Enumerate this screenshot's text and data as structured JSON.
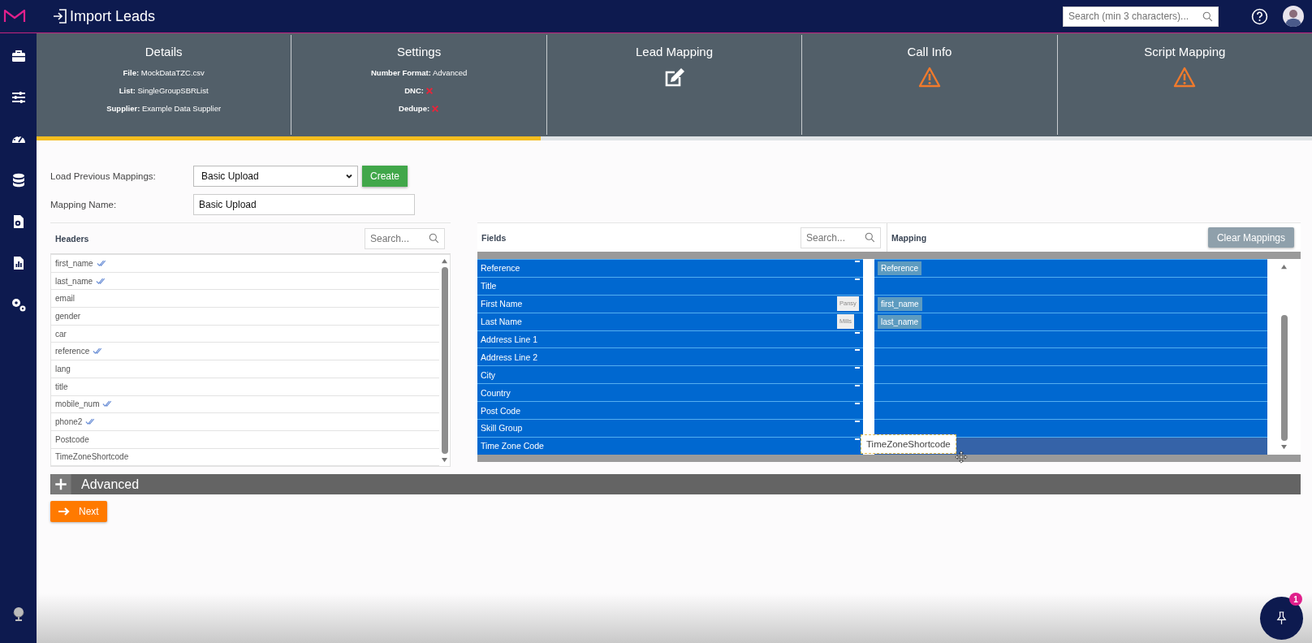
{
  "header": {
    "title": "Import Leads",
    "search": {
      "placeholder": "Search (min 3 characters)..."
    }
  },
  "steps": [
    {
      "title": "Details",
      "kind": "summary",
      "lines": [
        {
          "label": "File:",
          "value": "MockDataTZC.csv"
        },
        {
          "label": "List:",
          "value": "SingleGroupSBRList"
        },
        {
          "label": "Supplier:",
          "value": "Example Data Supplier"
        }
      ]
    },
    {
      "title": "Settings",
      "kind": "summary",
      "lines": [
        {
          "label": "Number Format:",
          "value": "Advanced"
        },
        {
          "label": "DNC:",
          "on": false
        },
        {
          "label": "Dedupe:",
          "on": false
        }
      ]
    },
    {
      "title": "Lead Mapping",
      "kind": "edit"
    },
    {
      "title": "Call Info",
      "kind": "warning"
    },
    {
      "title": "Script Mapping",
      "kind": "warning"
    }
  ],
  "progress": {
    "level": 0.395
  },
  "form": {
    "load_previous": {
      "label": "Load Previous Mappings:",
      "value": "Basic Upload"
    },
    "create_button": "Create",
    "mapping_name": {
      "label": "Mapping Name:",
      "value": "Basic Upload"
    }
  },
  "headers_panel": {
    "title": "Headers",
    "search": {
      "placeholder": "Search..."
    },
    "items": [
      {
        "label": "first_name",
        "mapped": true
      },
      {
        "label": "last_name",
        "mapped": true
      },
      {
        "label": "email",
        "mapped": false
      },
      {
        "label": "gender",
        "mapped": false
      },
      {
        "label": "car",
        "mapped": false
      },
      {
        "label": "reference",
        "mapped": true
      },
      {
        "label": "lang",
        "mapped": false
      },
      {
        "label": "title",
        "mapped": false
      },
      {
        "label": "mobile_num",
        "mapped": true
      },
      {
        "label": "phone2",
        "mapped": true
      },
      {
        "label": "Postcode",
        "mapped": false
      },
      {
        "label": "TimeZoneShortcode",
        "mapped": false
      }
    ]
  },
  "fields_panel": {
    "title": "Fields",
    "search": {
      "placeholder": "Search..."
    },
    "mapping_title": "Mapping",
    "clear_button": "Clear Mappings",
    "rows": [
      {
        "field": "Reference",
        "mapping": "Reference",
        "hovered": false
      },
      {
        "field": "Title",
        "hovered": false
      },
      {
        "field": "First Name",
        "sample": "Pansy",
        "mapping": "first_name",
        "hovered": false
      },
      {
        "field": "Last Name",
        "sample": "Mills",
        "mapping": "last_name",
        "hovered": false
      },
      {
        "field": "Address Line 1",
        "hovered": false
      },
      {
        "field": "Address Line 2",
        "hovered": false
      },
      {
        "field": "City",
        "hovered": false
      },
      {
        "field": "Country",
        "hovered": false
      },
      {
        "field": "Post Code",
        "hovered": false
      },
      {
        "field": "Skill Group",
        "hovered": false
      },
      {
        "field": "Time Zone Code",
        "hovered": true
      }
    ],
    "drag_item": "TimeZoneShortcode"
  },
  "advanced": {
    "label": "Advanced",
    "expanded": false
  },
  "next_button": "Next",
  "pin_button": {
    "badge": "1"
  }
}
